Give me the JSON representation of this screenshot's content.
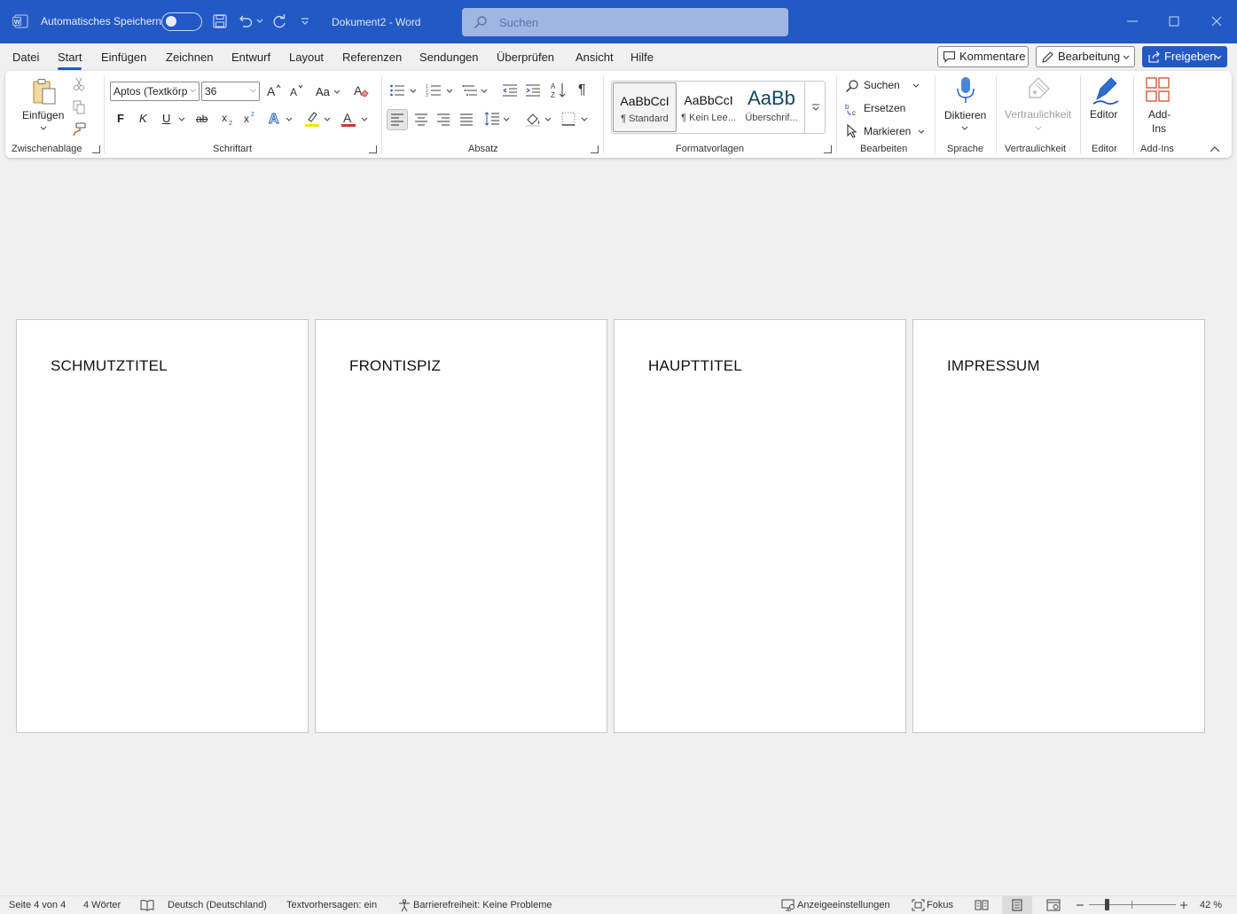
{
  "titlebar": {
    "autosave_label": "Automatisches Speichern",
    "document_title": "Dokument2  -  Word",
    "search_placeholder": "Suchen"
  },
  "menu": {
    "items": [
      "Datei",
      "Start",
      "Einfügen",
      "Zeichnen",
      "Entwurf",
      "Layout",
      "Referenzen",
      "Sendungen",
      "Überprüfen",
      "Ansicht",
      "Hilfe"
    ],
    "active": "Start",
    "comments_label": "Kommentare",
    "editing_label": "Bearbeitung",
    "share_label": "Freigeben"
  },
  "ribbon": {
    "clipboard": {
      "paste_label": "Einfügen",
      "group_label": "Zwischenablage"
    },
    "font": {
      "font_name": "Aptos (Textkörp",
      "font_size": "36",
      "change_case": "Aa",
      "group_label": "Schriftart",
      "bold": "F",
      "italic": "K",
      "underline": "U",
      "strike": "ab"
    },
    "paragraph": {
      "group_label": "Absatz"
    },
    "styles": {
      "group_label": "Formatvorlagen",
      "items": [
        {
          "sample": "AaBbCcI",
          "name": "¶ Standard"
        },
        {
          "sample": "AaBbCcI",
          "name": "¶ Kein Lee..."
        },
        {
          "sample": "AaBb",
          "name": "Überschrif..."
        }
      ]
    },
    "editing": {
      "find": "Suchen",
      "replace": "Ersetzen",
      "select": "Markieren",
      "group_label": "Bearbeiten"
    },
    "voice": {
      "dictate": "Diktieren",
      "group_label": "Sprache"
    },
    "sensitivity": {
      "label": "Vertraulichkeit",
      "group_label": "Vertraulichkeit"
    },
    "editor": {
      "label": "Editor",
      "group_label": "Editor"
    },
    "addins": {
      "label_line1": "Add-",
      "label_line2": "Ins",
      "group_label": "Add-Ins"
    }
  },
  "pages": [
    {
      "heading": "SCHMUTZTITEL"
    },
    {
      "heading": "FRONTISPIZ"
    },
    {
      "heading": "HAUPTTITEL"
    },
    {
      "heading": "IMPRESSUM"
    }
  ],
  "statusbar": {
    "page_info": "Seite 4 von 4",
    "word_count": "4 Wörter",
    "language": "Deutsch (Deutschland)",
    "text_predictions": "Textvorhersagen: ein",
    "accessibility": "Barrierefreiheit: Keine Probleme",
    "display_settings": "Anzeigeeinstellungen",
    "focus": "Fokus",
    "zoom": "42 %",
    "zoom_fraction": 0.2
  },
  "colors": {
    "accent": "#2359c4",
    "titlebar": "#2359c4",
    "font_color_bar": "#d13438",
    "highlight_bar": "#f5e800"
  }
}
